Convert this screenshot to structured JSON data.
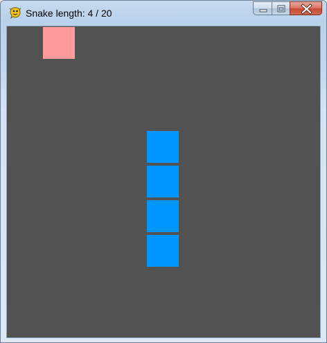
{
  "window": {
    "title": "Snake length: 4 / 20"
  },
  "icons": {
    "app": "pygame-snake-icon",
    "minimize": "minimize-icon",
    "maximize": "maximize-icon",
    "close": "close-icon"
  },
  "colors": {
    "board_background": "#525252",
    "snake": "#0096ff",
    "food": "#ff9b9b"
  },
  "game": {
    "snake_length": 4,
    "target_length": 20,
    "grid_columns": 9,
    "grid_rows": 9,
    "food": {
      "col": 1,
      "row": 0
    },
    "snake": [
      {
        "col": 4,
        "row": 3
      },
      {
        "col": 4,
        "row": 4
      },
      {
        "col": 4,
        "row": 5
      },
      {
        "col": 4,
        "row": 6
      }
    ]
  }
}
